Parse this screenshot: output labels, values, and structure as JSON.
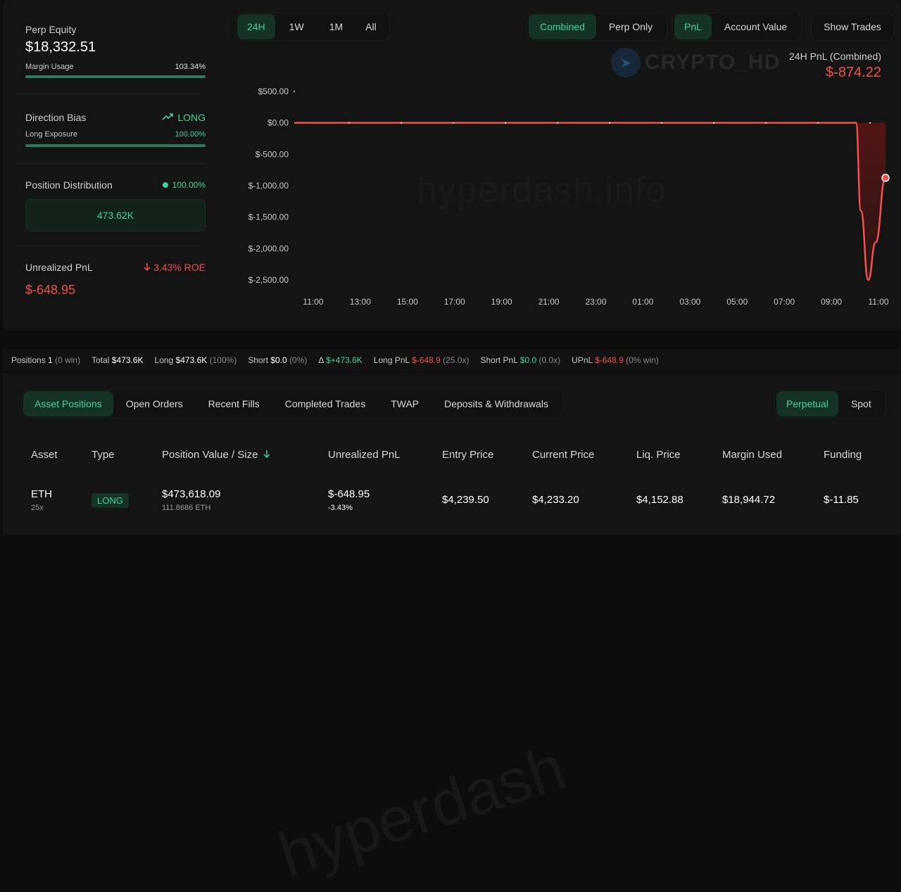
{
  "summary": {
    "perp_equity_label": "Perp Equity",
    "perp_equity_value": "$18,332.51",
    "margin_usage_label": "Margin Usage",
    "margin_usage_value": "103.34%",
    "direction_bias_label": "Direction Bias",
    "direction_bias_value": "LONG",
    "long_exposure_label": "Long Exposure",
    "long_exposure_value": "100.00%",
    "position_distribution_label": "Position Distribution",
    "position_distribution_pct": "100.00%",
    "position_distribution_amount": "473.62K",
    "unrealized_pnl_label": "Unrealized PnL",
    "unrealized_pnl_roe": "3.43% ROE",
    "unrealized_pnl_value": "$-648.95"
  },
  "time_ranges": [
    "24H",
    "1W",
    "1M",
    "All"
  ],
  "time_range_active": 0,
  "mode_toggle": [
    "Combined",
    "Perp Only"
  ],
  "metric_toggle": [
    "PnL",
    "Account Value"
  ],
  "show_trades_label": "Show Trades",
  "pnl_header": {
    "label": "24H PnL (Combined)",
    "value": "$-874.22"
  },
  "watermark": "hyperdash.info",
  "logo_text": "CRYPTO_HD",
  "chart_data": {
    "type": "area",
    "yticks": [
      "$500.00",
      "$0.00",
      "$-500.00",
      "$-1,000.00",
      "$-1,500.00",
      "$-2,000.00",
      "$-2,500.00"
    ],
    "ytick_values": [
      500,
      0,
      -500,
      -1000,
      -1500,
      -2000,
      -2500
    ],
    "xticks": [
      "11:00",
      "13:00",
      "15:00",
      "17:00",
      "19:00",
      "21:00",
      "23:00",
      "01:00",
      "03:00",
      "05:00",
      "07:00",
      "09:00",
      "11:00"
    ],
    "ylim": [
      -2500,
      500
    ],
    "series": [
      {
        "values": [
          {
            "t": 0,
            "v": 0
          },
          {
            "t": 22.8,
            "v": 0
          },
          {
            "t": 23.0,
            "v": -1400
          },
          {
            "t": 23.3,
            "v": -2500
          },
          {
            "t": 23.6,
            "v": -1900
          },
          {
            "t": 24.0,
            "v": -874.22
          }
        ]
      }
    ],
    "colors": {
      "line": "#f0524d",
      "fill": "#5a1515"
    }
  },
  "stats": {
    "positions_label": "Positions",
    "positions_value": "1",
    "positions_meta": "(0 win)",
    "total_label": "Total",
    "total_value": "$473.6K",
    "long_label": "Long",
    "long_value": "$473.6K",
    "long_meta": "(100%)",
    "short_label": "Short",
    "short_value": "$0.0",
    "short_meta": "(0%)",
    "delta_label": "Δ",
    "delta_value": "$+473.6K",
    "longpnl_label": "Long PnL",
    "longpnl_value": "$-648.9",
    "longpnl_meta": "(25.0x)",
    "shortpnl_label": "Short PnL",
    "shortpnl_value": "$0.0",
    "shortpnl_meta": "(0.0x)",
    "upnl_label": "UPnL",
    "upnl_value": "$-648.9",
    "upnl_meta": "(0% win)"
  },
  "tabs": [
    "Asset Positions",
    "Open Orders",
    "Recent Fills",
    "Completed Trades",
    "TWAP",
    "Deposits & Withdrawals"
  ],
  "market_toggle": [
    "Perpetual",
    "Spot"
  ],
  "table": {
    "headers": [
      "Asset",
      "Type",
      "Position Value / Size",
      "Unrealized PnL",
      "Entry Price",
      "Current Price",
      "Liq. Price",
      "Margin Used",
      "Funding"
    ],
    "sort_icon": "arrow-down-icon",
    "row": {
      "asset": "ETH",
      "leverage": "25x",
      "type": "LONG",
      "position_value": "$473,618.09",
      "position_size": "111.8686 ETH",
      "upnl": "$-648.95",
      "upnl_pct": "-3.43%",
      "entry": "$4,239.50",
      "current": "$4,233.20",
      "liq": "$4,152.88",
      "margin": "$18,944.72",
      "funding": "$-11.85"
    }
  },
  "colors": {
    "accent": "#3fd39a",
    "negative": "#f0524d",
    "background": "#0d0d0d"
  }
}
